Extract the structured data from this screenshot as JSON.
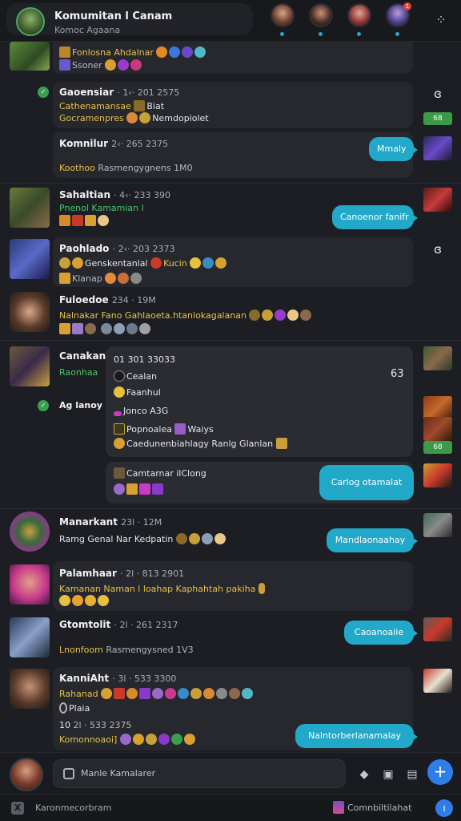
{
  "header": {
    "title": "Komumitan l Canam",
    "subtitle": "Komoc Agaana",
    "notification_count": "1",
    "menu_icon": "grid-icon"
  },
  "messages": [
    {
      "id": "m0",
      "line1": "Fonlosna Ahdalnar",
      "line2": "Ssoner"
    },
    {
      "id": "m1",
      "name": "Gaoensiar",
      "meta": "· 1‹· 201 2575",
      "line1": "Cathenamansae",
      "line1b": "Biat",
      "line2": "Gocramenpres",
      "line2b": "Nemdopiolet"
    },
    {
      "id": "m2",
      "name": "Komnilur",
      "meta": "2‹· 265 2375",
      "line1": "Koothoo",
      "line1b": "Rasmengygnens 1M0",
      "bubble": "Mmaly"
    },
    {
      "id": "m3",
      "name": "Sahaltian",
      "meta": "· 4‹· 233 390",
      "line1": "Pnenol Kamamian l",
      "bubble": "Canoenor fanifr"
    },
    {
      "id": "m4",
      "name": "Paohlado",
      "meta": "· 2‹· 203 2373",
      "line1": "Genskentanlal",
      "line1b": "Kucin",
      "line2": "Klanap"
    },
    {
      "id": "m5",
      "name": "Fuloedoe",
      "meta": "234 · 19M",
      "line1": "Nalnakar Fano  Gahlaoeta.htanlokagalanan"
    },
    {
      "id": "m6",
      "name": "Canakan",
      "line1": "Raonhaa",
      "sub_name": "Ag lanoy",
      "card_head": "01 301 33033",
      "card_right": "63",
      "card_items": [
        "Cealan",
        "Faanhul",
        "Jonco A3G",
        "Popnoalea",
        "Waiys",
        "Caedunenbiahlagy Ranlg Glanlan"
      ],
      "sub_card": "Camtarnar ilClong",
      "bubble": "Carlog otamalat"
    },
    {
      "id": "m7",
      "name": "Manarkant",
      "meta": "23l · 12M",
      "line1": "Ramg Genal Nar Kedpatin",
      "bubble": "Mandlaonaahay"
    },
    {
      "id": "m8",
      "name": "Palamhaar",
      "meta": "· 2l · 813 2901",
      "line1": "Kamanan Naman l loahap Kaphahtah pakiha",
      "line2": ""
    },
    {
      "id": "m9",
      "name": "Gtomtolit",
      "meta": "· 2l · 261 2317",
      "line1": "Lnonfoom",
      "line1b": "Rasmengysned 1V3",
      "bubble": "Caoanoaiie"
    },
    {
      "id": "m10",
      "name": "KanniAht",
      "meta": "· 3l · 533 3300",
      "line1": "Rahanad",
      "line2": "Plaia",
      "line3": "10",
      "line3b": "2l · 533 2375",
      "line4": "Komonnoaoi]",
      "bubble": "Nalntorberlanamalay"
    }
  ],
  "side": {
    "tag1": "68",
    "tag2": "68"
  },
  "composer": {
    "placeholder": "Manle Kamalarer"
  },
  "footer": {
    "left": "Karonmecorbram",
    "right": "Comnbiltilahat"
  }
}
